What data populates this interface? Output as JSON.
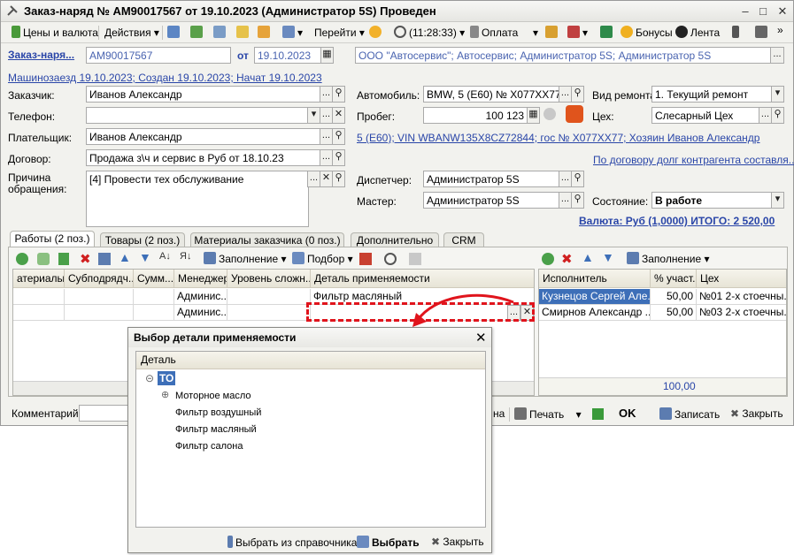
{
  "window": {
    "title": "Заказ-наряд № АМ90017567 от 19.10.2023 (Администратор 5S) Проведен"
  },
  "toolbar": {
    "prices": "Цены и валюта",
    "actions": "Действия",
    "goto": "Перейти",
    "time": "(11:28:33)",
    "payment": "Оплата",
    "bonuses": "Бонусы",
    "feed": "Лента"
  },
  "header": {
    "doc_label": "Заказ-наря...",
    "doc_number": "АМ90017567",
    "date_from_label": "от",
    "date": "19.10.2023",
    "org": "ООО \"Автосервис\"; Автосервис; Администратор 5S; Администратор 5S",
    "info_link": "Машинозаезд 19.10.2023; Создан 19.10.2023; Начат 19.10.2023"
  },
  "form": {
    "customer_label": "Заказчик:",
    "customer": "Иванов Александр",
    "phone_label": "Телефон:",
    "phone": "",
    "payer_label": "Плательщик:",
    "payer": "Иванов Александр",
    "contract_label": "Договор:",
    "contract": "Продажа з\\ч и сервис в Руб от 18.10.23",
    "reason_label_1": "Причина",
    "reason_label_2": "обращения:",
    "reason": "[4] Провести тех обслуживание",
    "car_label": "Автомобиль:",
    "car": "BMW, 5 (E60) № Х077ХХ77 VI",
    "mileage_label": "Пробег:",
    "mileage": "100 123",
    "vin_link": "5 (E60); VIN WBANW135X8CZ72844; гос № Х077ХХ77; Хозяин Иванов Александр",
    "debt_link": "По договору долг контрагента составля...",
    "dispatcher_label": "Диспетчер:",
    "dispatcher": "Администратор 5S",
    "master_label": "Мастер:",
    "master": "Администратор 5S",
    "repair_type_label": "Вид ремонта:",
    "repair_type": "1. Текущий ремонт",
    "workshop_label": "Цех:",
    "workshop": "Слесарный Цех",
    "status_label": "Состояние:",
    "status": "В работе",
    "total": "Валюта: Руб (1,0000) ИТОГО: 2 520,00"
  },
  "tabs": [
    {
      "label": "Работы (2 поз.)"
    },
    {
      "label": "Товары (2 поз.)"
    },
    {
      "label": "Материалы заказчика (0 поз.)"
    },
    {
      "label": "Дополнительно"
    },
    {
      "label": "CRM"
    }
  ],
  "works_toolbar": {
    "fill": "Заполнение",
    "selection": "Подбор"
  },
  "works_grid": {
    "columns": [
      "атериалы",
      "Субподрядч...",
      "Сумм...",
      "Менеджер",
      "Уровень сложн...",
      "Деталь применяемости"
    ],
    "rows": [
      [
        "",
        "",
        "",
        "Админис...",
        "",
        "Фильтр масляный"
      ],
      [
        "",
        "",
        "",
        "Админис...",
        "",
        ""
      ]
    ]
  },
  "executors_toolbar": {
    "fill": "Заполнение"
  },
  "executors_grid": {
    "columns": [
      "Исполнитель",
      "% участ...",
      "Цех"
    ],
    "rows": [
      [
        "Кузнецов Сергей Але...",
        "50,00",
        "№01  2-х стоечны..."
      ],
      [
        "Смирнов Александр ...",
        "50,00",
        "№03  2-х стоечны..."
      ]
    ],
    "total": "100,00"
  },
  "bottom": {
    "comment_label": "Комментарий:",
    "print": "Печать",
    "ok": "OK",
    "save": "Записать",
    "close": "Закрыть",
    "partial": "на"
  },
  "dialog": {
    "title": "Выбор детали применяемости",
    "column": "Деталь",
    "root": "ТО",
    "items": [
      "Моторное масло",
      "Фильтр воздушный",
      "Фильтр масляный",
      "Фильтр салона"
    ],
    "btn_catalog": "Выбрать из справочника",
    "btn_select": "Выбрать",
    "btn_close": "Закрыть"
  },
  "colors": {
    "accent": "#3d6fb8",
    "link": "#2a46a8",
    "callout": "#e0141c"
  }
}
